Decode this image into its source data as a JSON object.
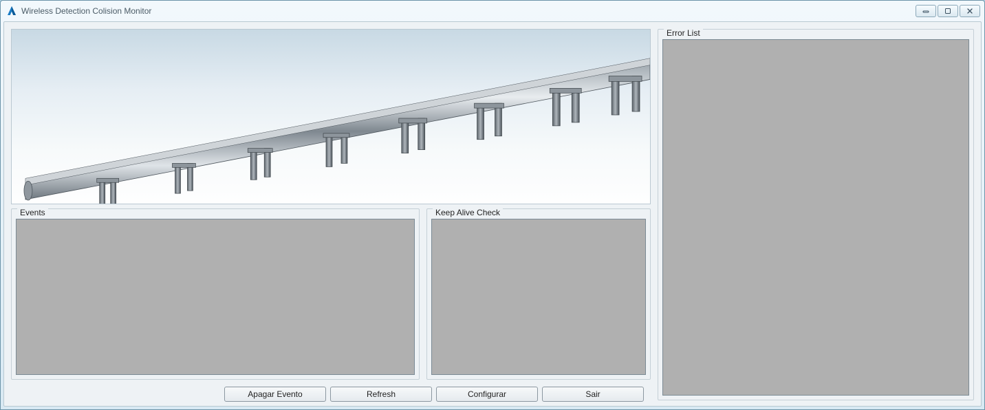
{
  "window": {
    "title": "Wireless Detection Colision Monitor"
  },
  "panels": {
    "events_label": "Events",
    "keepalive_label": "Keep Alive Check",
    "errors_label": "Error List"
  },
  "buttons": {
    "apagar_evento": "Apagar Evento",
    "refresh": "Refresh",
    "configurar": "Configurar",
    "sair": "Sair"
  }
}
